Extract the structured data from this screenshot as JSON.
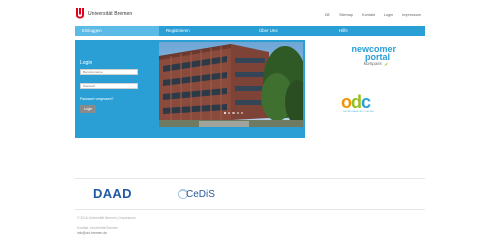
{
  "header": {
    "logo_text": "Universität Bremen",
    "top_links": [
      "DE",
      "Sitemap",
      "Kontakt",
      "Login",
      "Impressum"
    ]
  },
  "nav": {
    "items": [
      "Einloggen",
      "Registrieren",
      "Über Uns",
      "Hilfe"
    ],
    "active_index": 0
  },
  "login": {
    "title": "Login",
    "username_placeholder": "Benutzername",
    "password_placeholder": "Passwort",
    "forgot_link": "Passwort vergessen?",
    "login_button": "Login"
  },
  "slider": {
    "dot_count": 5,
    "active_dot": 0
  },
  "newcomer_logo": {
    "line1": "newcomer",
    "line2": "portal",
    "line3": "kompass"
  },
  "odc_logo": {
    "letters": [
      "o",
      "d",
      "c"
    ],
    "subtitle": "ONLINE DIAGNOSTIC CENTER"
  },
  "footer": {
    "daad": "DAAD",
    "cedis": "CeDiS",
    "copyright": "© 2016 Universität Bremen | Impressum",
    "contact_line1": "Kontakt: Universität Bremen",
    "contact_line2": "info@uni-bremen.de"
  },
  "colors": {
    "primary": "#2a9fd6",
    "nav_active": "#5bbae6",
    "button_grey": "#8a8a8a",
    "uni_red": "#e2001a",
    "daad_blue": "#1e5aa5",
    "odc_o": "#f39200",
    "odc_d": "#95c11f",
    "odc_c": "#2a9fd6"
  }
}
